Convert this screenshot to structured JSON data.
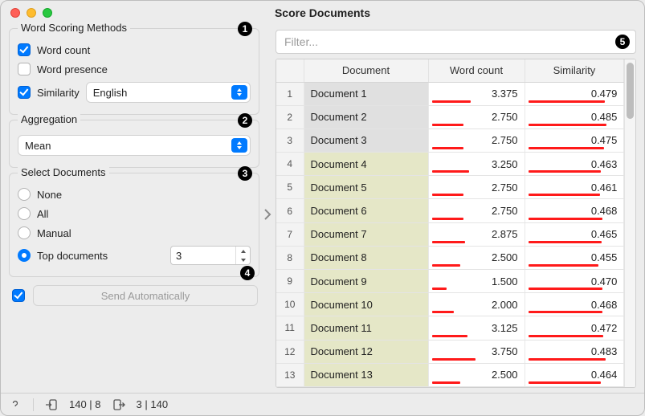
{
  "window": {
    "title": "Score Documents"
  },
  "wordScoring": {
    "legend": "Word Scoring Methods",
    "num": "1",
    "wordCount": {
      "label": "Word count",
      "checked": true
    },
    "wordPresence": {
      "label": "Word presence",
      "checked": false
    },
    "similarity": {
      "label": "Similarity",
      "checked": true,
      "lang": "English"
    }
  },
  "aggregation": {
    "legend": "Aggregation",
    "num": "2",
    "value": "Mean"
  },
  "selectDocs": {
    "legend": "Select Documents",
    "num": "3",
    "none": "None",
    "all": "All",
    "manual": "Manual",
    "top": "Top documents",
    "topValue": "3",
    "selected": "top"
  },
  "send": {
    "num": "4",
    "label": "Send Automatically",
    "checked": true
  },
  "filter": {
    "placeholder": "Filter...",
    "num": "5"
  },
  "table": {
    "columns": [
      "",
      "Document",
      "Word count",
      "Similarity"
    ],
    "rows": [
      {
        "n": "1",
        "doc": "Document 1",
        "wc": "3.375",
        "wcBar": 0.8,
        "sim": "0.479",
        "simBar": 0.95,
        "sel": true
      },
      {
        "n": "2",
        "doc": "Document 2",
        "wc": "2.750",
        "wcBar": 0.65,
        "sim": "0.485",
        "simBar": 0.97,
        "sel": true
      },
      {
        "n": "3",
        "doc": "Document 3",
        "wc": "2.750",
        "wcBar": 0.65,
        "sim": "0.475",
        "simBar": 0.94,
        "sel": true
      },
      {
        "n": "4",
        "doc": "Document 4",
        "wc": "3.250",
        "wcBar": 0.77,
        "sim": "0.463",
        "simBar": 0.9,
        "sel": false
      },
      {
        "n": "5",
        "doc": "Document 5",
        "wc": "2.750",
        "wcBar": 0.65,
        "sim": "0.461",
        "simBar": 0.89,
        "sel": false
      },
      {
        "n": "6",
        "doc": "Document 6",
        "wc": "2.750",
        "wcBar": 0.65,
        "sim": "0.468",
        "simBar": 0.92,
        "sel": false
      },
      {
        "n": "7",
        "doc": "Document 7",
        "wc": "2.875",
        "wcBar": 0.68,
        "sim": "0.465",
        "simBar": 0.91,
        "sel": false
      },
      {
        "n": "8",
        "doc": "Document 8",
        "wc": "2.500",
        "wcBar": 0.59,
        "sim": "0.455",
        "simBar": 0.87,
        "sel": false
      },
      {
        "n": "9",
        "doc": "Document 9",
        "wc": "1.500",
        "wcBar": 0.3,
        "sim": "0.470",
        "simBar": 0.92,
        "sel": false
      },
      {
        "n": "10",
        "doc": "Document 10",
        "wc": "2.000",
        "wcBar": 0.45,
        "sim": "0.468",
        "simBar": 0.92,
        "sel": false
      },
      {
        "n": "11",
        "doc": "Document 11",
        "wc": "3.125",
        "wcBar": 0.74,
        "sim": "0.472",
        "simBar": 0.93,
        "sel": false
      },
      {
        "n": "12",
        "doc": "Document 12",
        "wc": "3.750",
        "wcBar": 0.9,
        "sim": "0.483",
        "simBar": 0.96,
        "sel": false
      },
      {
        "n": "13",
        "doc": "Document 13",
        "wc": "2.500",
        "wcBar": 0.59,
        "sim": "0.464",
        "simBar": 0.9,
        "sel": false
      }
    ]
  },
  "status": {
    "in": "140 | 8",
    "out": "3 | 140"
  }
}
